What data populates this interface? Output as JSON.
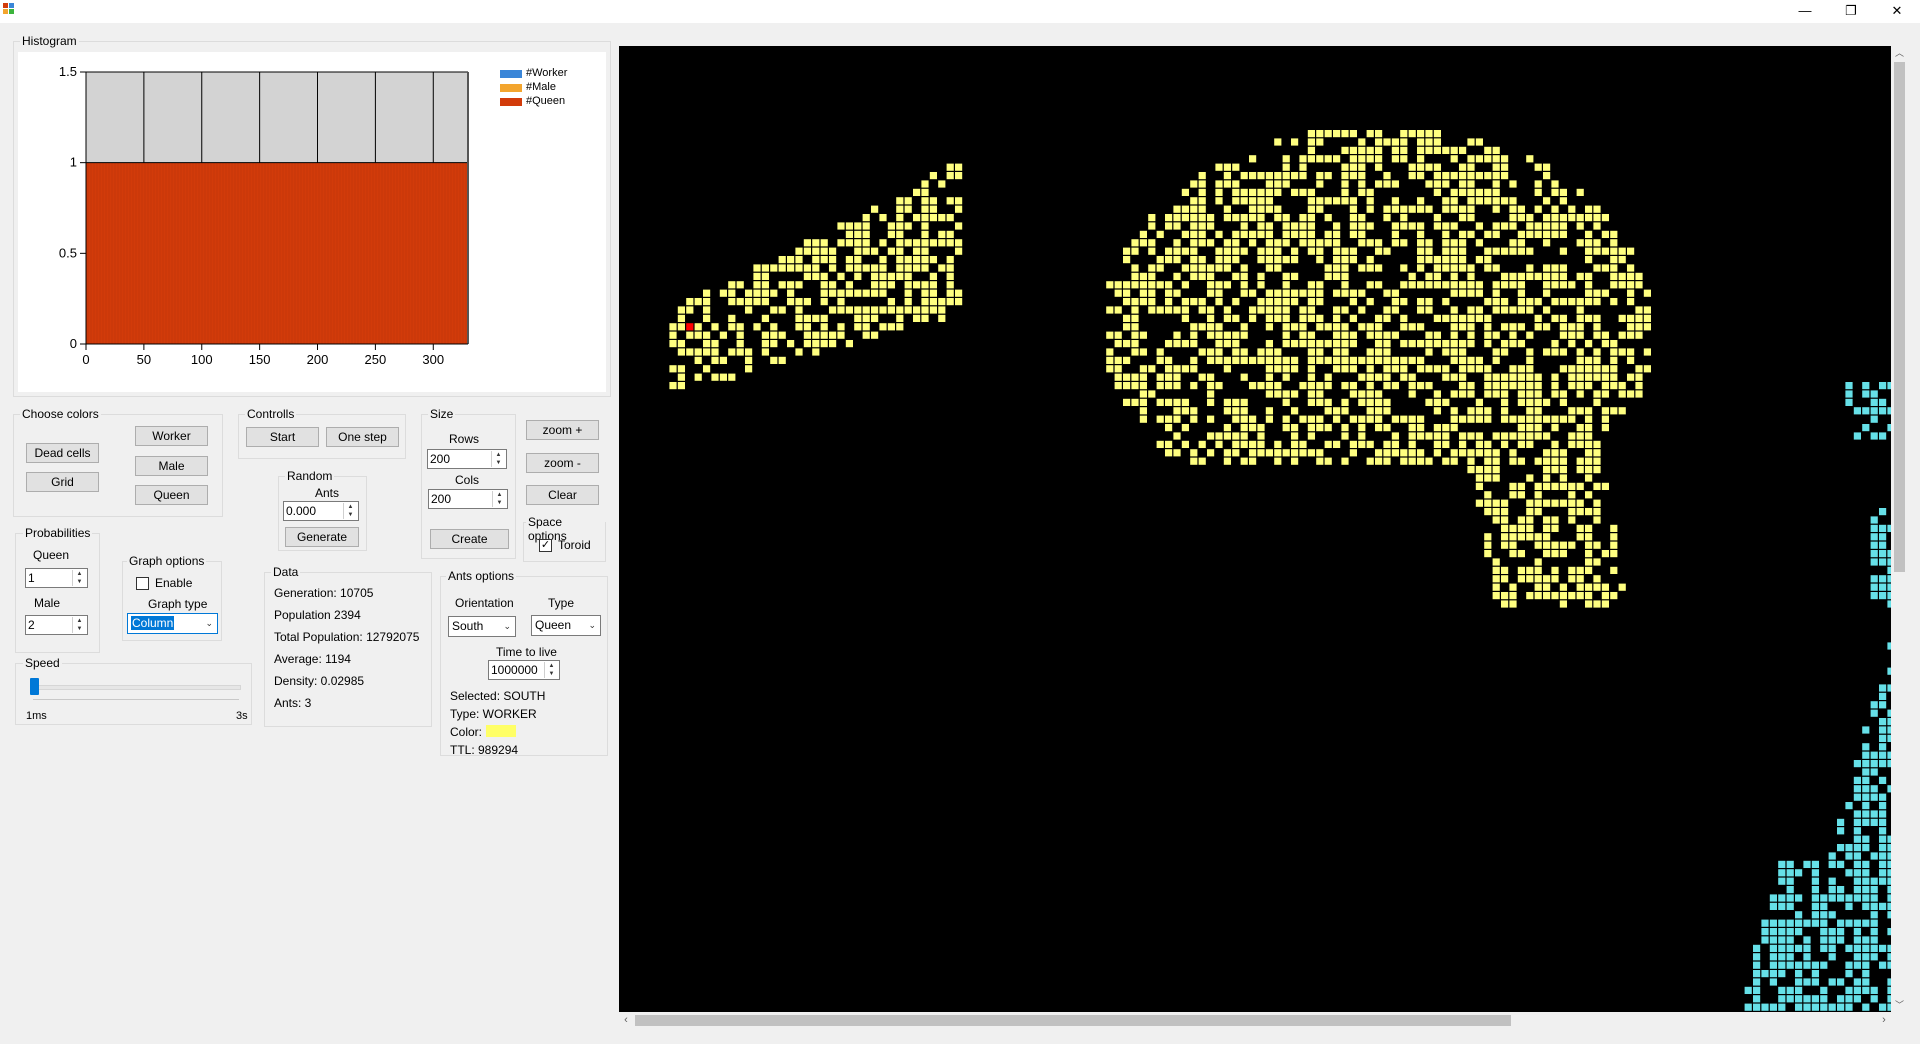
{
  "window": {
    "minimize": "—",
    "restore": "❐",
    "close": "✕"
  },
  "histogram": {
    "title": "Histogram",
    "legend": [
      {
        "label": "#Worker",
        "color": "#3a86d8"
      },
      {
        "label": "#Male",
        "color": "#f3a52e"
      },
      {
        "label": "#Queen",
        "color": "#d23b0a"
      }
    ]
  },
  "chart_data": {
    "type": "bar",
    "x_range": [
      0,
      330
    ],
    "x_ticks": [
      "0",
      "50",
      "100",
      "150",
      "200",
      "250",
      "300"
    ],
    "y_ticks": [
      "0",
      "0.5",
      "1",
      "1.5"
    ],
    "ylim": [
      0,
      1.5
    ],
    "series": [
      {
        "name": "#Worker",
        "value": 0
      },
      {
        "name": "#Male",
        "value": 0
      },
      {
        "name": "#Queen",
        "value": 1
      }
    ]
  },
  "colors": {
    "title": "Choose colors",
    "dead_cells": "Dead cells",
    "grid": "Grid",
    "worker": "Worker",
    "male": "Male",
    "queen": "Queen"
  },
  "controls": {
    "title": "Controlls",
    "start": "Start",
    "one_step": "One step"
  },
  "random": {
    "title": "Random",
    "ants_label": "Ants",
    "ants_value": "0.000",
    "generate": "Generate"
  },
  "size": {
    "title": "Size",
    "rows_label": "Rows",
    "rows_value": "200",
    "cols_label": "Cols",
    "cols_value": "200",
    "create": "Create"
  },
  "zoom": {
    "zoom_in": "zoom +",
    "zoom_out": "zoom -",
    "clear": "Clear"
  },
  "space": {
    "title": "Space options",
    "toroid": "Toroid",
    "toroid_checked": true
  },
  "probabilities": {
    "title": "Probabilities",
    "queen_label": "Queen",
    "queen_value": "1",
    "male_label": "Male",
    "male_value": "2"
  },
  "graph": {
    "title": "Graph options",
    "enable": "Enable",
    "enable_checked": false,
    "type_label": "Graph type",
    "type_value": "Column"
  },
  "data": {
    "title": "Data",
    "generation": "Generation: 10705",
    "population": "Population 2394",
    "total_population": "Total Population: 12792075",
    "average": "Average: 1194",
    "density": "Density: 0.02985",
    "ants": "Ants: 3"
  },
  "speed": {
    "title": "Speed",
    "min": "1ms",
    "max": "3s",
    "level": 0.0
  },
  "ants_options": {
    "title": "Ants options",
    "orientation_label": "Orientation",
    "orientation_value": "South",
    "type_label": "Type",
    "type_value": "Queen",
    "ttl_label": "Time to live",
    "ttl_value": "1000000",
    "selected": "Selected: SOUTH",
    "type_info": "Type: WORKER",
    "color_label": "Color:",
    "color_swatch": "#ffff66",
    "ttl_info": "TTL: 989294"
  },
  "world": {
    "background": "#000000",
    "worker_color": "#ffff80",
    "queen_color": "#66e0e8",
    "ant_marker_color": "#ff0000"
  }
}
